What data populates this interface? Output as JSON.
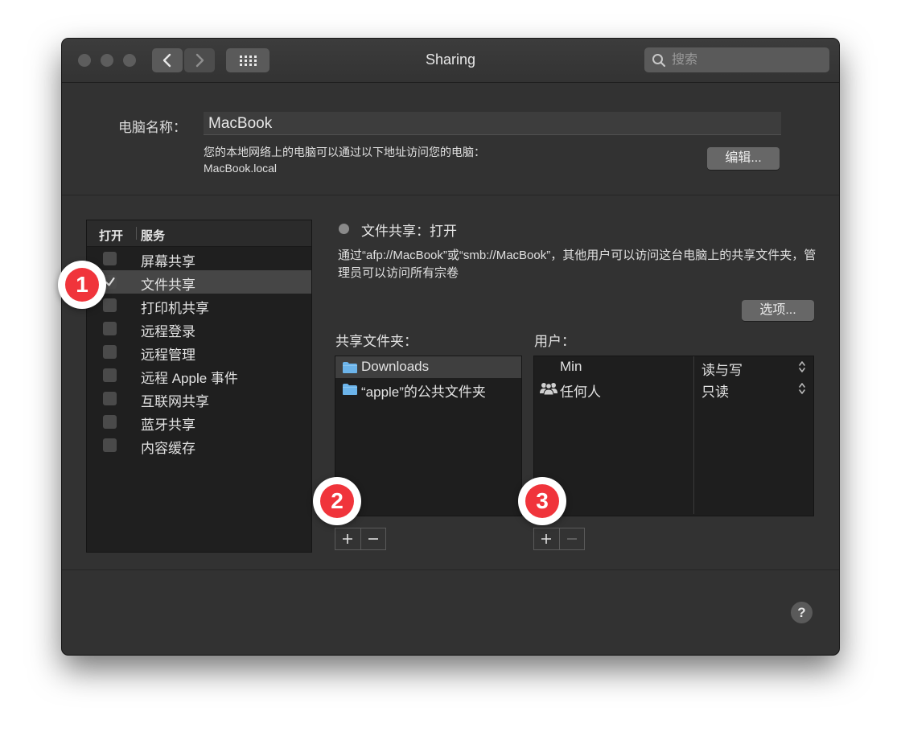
{
  "window": {
    "title": "Sharing"
  },
  "search": {
    "placeholder": "搜索"
  },
  "computer": {
    "name_label": "电脑名称：",
    "name_value": "MacBook",
    "address_desc": "您的本地网络上的电脑可以通过以下地址访问您的电脑：",
    "address_host": "MacBook.local",
    "edit_button": "编辑..."
  },
  "services": {
    "col_on": "打开",
    "col_service": "服务",
    "items": [
      {
        "label": "屏幕共享",
        "checked": false
      },
      {
        "label": "文件共享",
        "checked": true
      },
      {
        "label": "打印机共享",
        "checked": false
      },
      {
        "label": "远程登录",
        "checked": false
      },
      {
        "label": "远程管理",
        "checked": false
      },
      {
        "label": "远程 Apple 事件",
        "checked": false
      },
      {
        "label": "互联网共享",
        "checked": false
      },
      {
        "label": "蓝牙共享",
        "checked": false
      },
      {
        "label": "内容缓存",
        "checked": false
      }
    ]
  },
  "file_sharing": {
    "status": "文件共享：打开",
    "description": "通过“afp://MacBook”或“smb://MacBook”，其他用户可以访问这台电脑上的共享文件夹，管理员可以访问所有宗卷",
    "options_button": "选项..."
  },
  "shared_folders": {
    "label": "共享文件夹：",
    "items": [
      "Downloads",
      "“apple”的公共文件夹"
    ]
  },
  "users": {
    "label": "用户：",
    "items": [
      {
        "name": "Min",
        "permission": "读与写"
      },
      {
        "name": "任何人",
        "permission": "只读"
      }
    ]
  },
  "badges": [
    "1",
    "2",
    "3"
  ],
  "help": "?",
  "colors": {
    "badge": "#f0343b",
    "folder": "#6cb4ea",
    "window_bg": "#323232"
  }
}
